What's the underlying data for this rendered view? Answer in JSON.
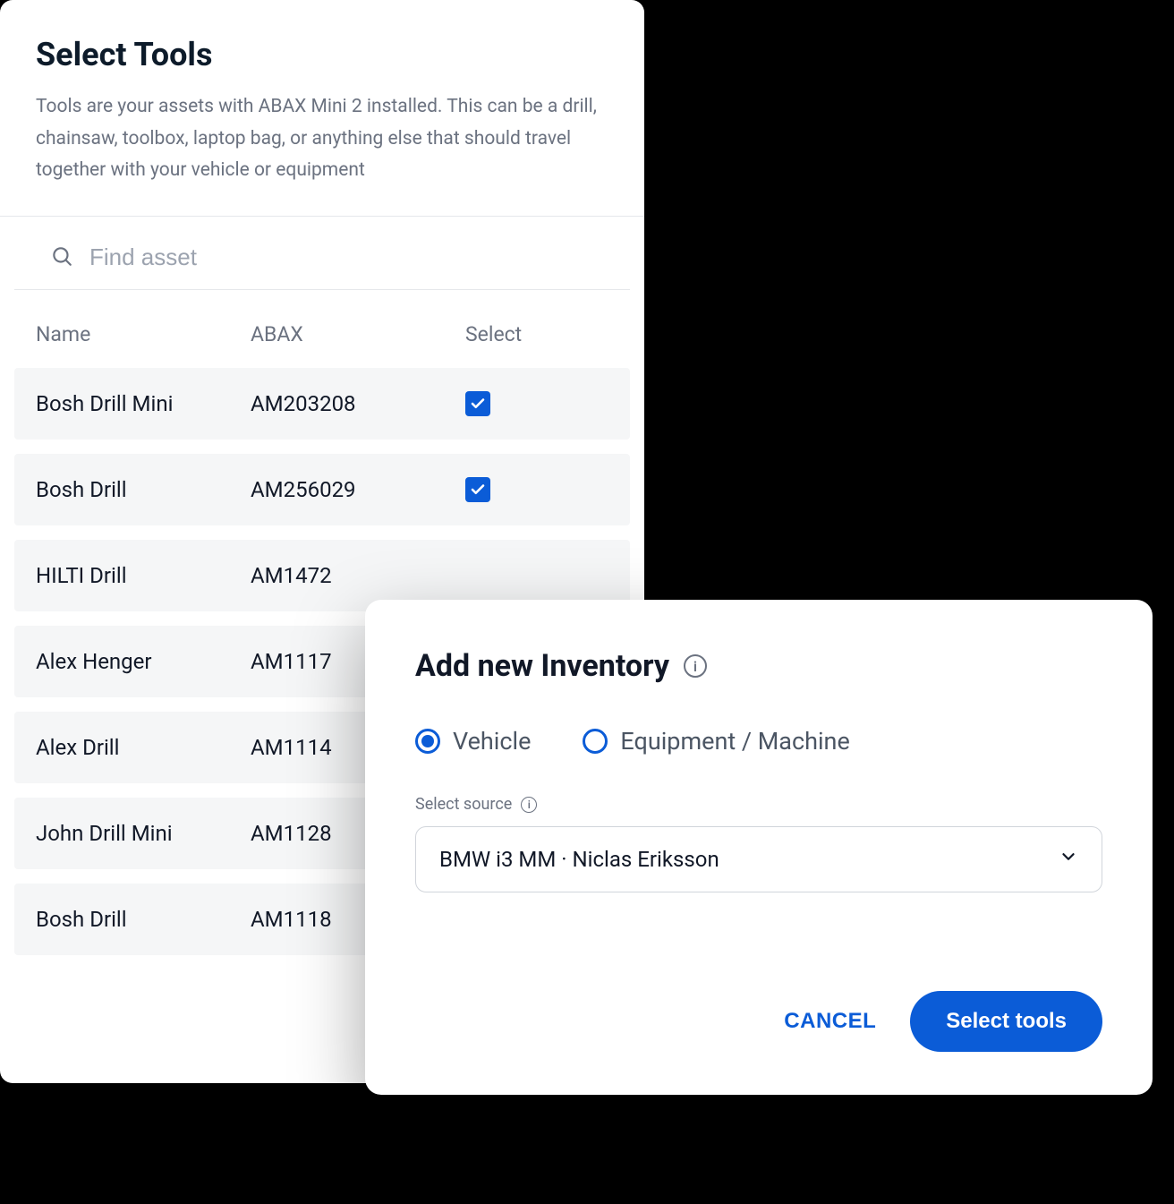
{
  "tools_panel": {
    "title": "Select Tools",
    "description": "Tools are your assets with ABAX Mini 2 installed. This can be a drill, chainsaw, toolbox, laptop bag, or anything else that should travel together with your vehicle or equipment",
    "search_placeholder": "Find asset",
    "columns": {
      "name": "Name",
      "abax": "ABAX",
      "select": "Select"
    },
    "rows": [
      {
        "name": "Bosh Drill Mini",
        "abax": "AM203208",
        "checked": true
      },
      {
        "name": "Bosh Drill",
        "abax": "AM256029",
        "checked": true
      },
      {
        "name": "HILTI Drill",
        "abax": "AM1472",
        "checked": false
      },
      {
        "name": "Alex Henger",
        "abax": "AM1117",
        "checked": false
      },
      {
        "name": "Alex Drill",
        "abax": "AM1114",
        "checked": false
      },
      {
        "name": "John Drill Mini",
        "abax": "AM1128",
        "checked": false
      },
      {
        "name": "Bosh Drill",
        "abax": "AM1118",
        "checked": false
      }
    ]
  },
  "modal": {
    "title": "Add new Inventory",
    "radios": {
      "vehicle": "Vehicle",
      "equipment": "Equipment / Machine",
      "selected": "vehicle"
    },
    "source_label": "Select source",
    "source_value": "BMW i3 MM · Niclas Eriksson",
    "cancel": "CANCEL",
    "primary": "Select tools"
  }
}
